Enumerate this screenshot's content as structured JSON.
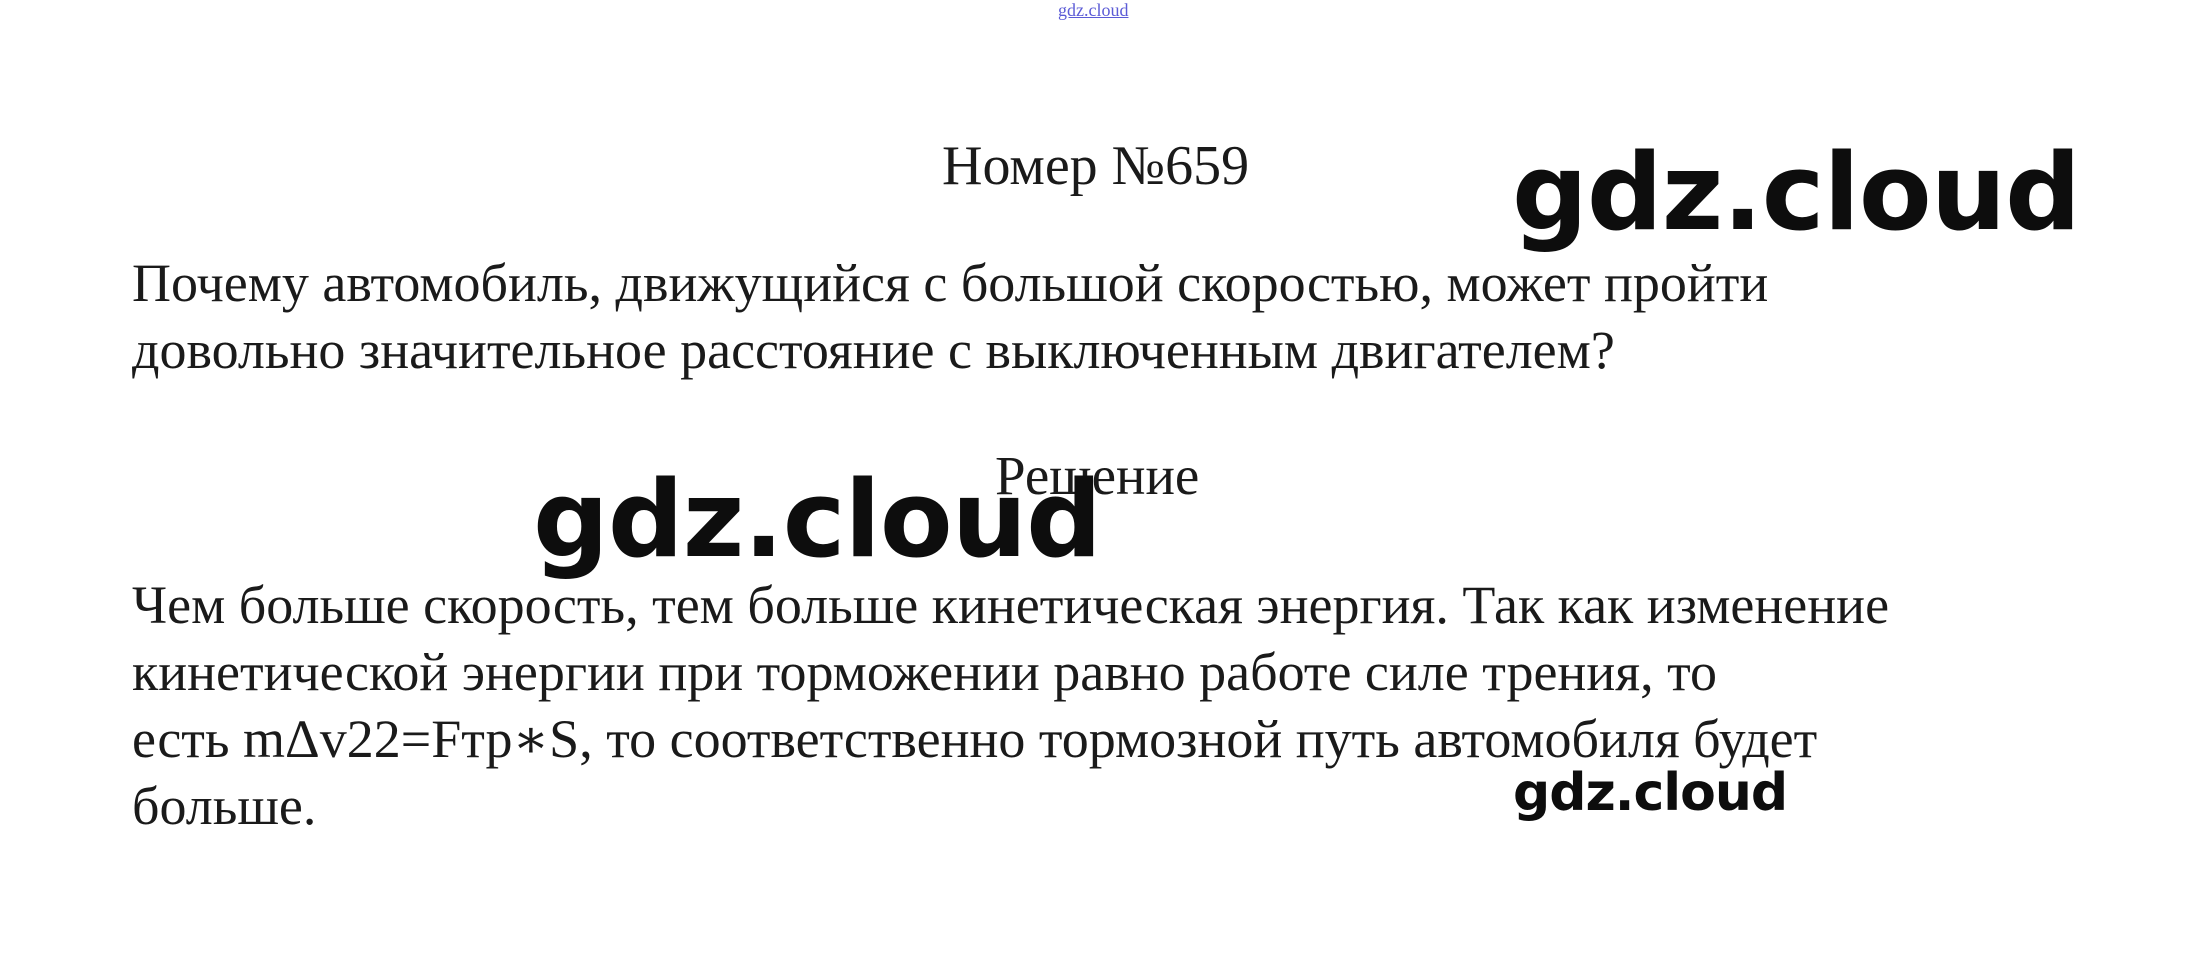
{
  "header_link": "gdz.cloud",
  "heading": "Номер №659",
  "question": {
    "line1": "Почему автомобиль, движущийся с большой скоростью, может пройти",
    "line2": "довольно значительное расстояние с выключенным двигателем?"
  },
  "solution_heading": "Решение",
  "answer": {
    "line1": "Чем больше скорость, тем больше кинетическая энергия. Так как изменение",
    "line2": "кинетической энергии при торможении равно работе силе трения, то",
    "line3": "есть mΔv22=Fтр∗S, то соответственно тормозной путь автомобиля будет",
    "line4": "больше."
  },
  "watermarks": {
    "large_top": "gdz.cloud",
    "large_middle": "gdz.cloud",
    "small_bottom": "gdz.cloud"
  }
}
